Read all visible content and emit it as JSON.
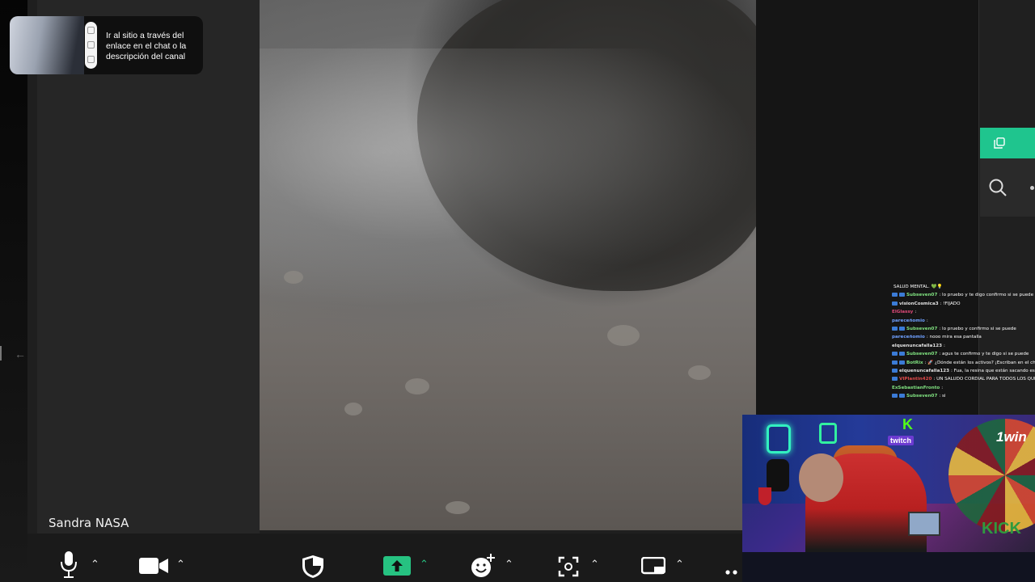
{
  "promo": {
    "text": "Ir al sitio a través del enlace en el chat o la descripción del canal"
  },
  "meeting": {
    "participant_name": "Sandra NASA"
  },
  "toolbar": {
    "icons": [
      "microphone-icon",
      "video-camera-icon",
      "security-shield-icon",
      "share-screen-icon",
      "reactions-icon",
      "apps-icon",
      "view-icon",
      "more-icon"
    ]
  },
  "side_panel": {
    "icons": [
      "copy-icon",
      "search-icon"
    ]
  },
  "chat": {
    "lines": [
      {
        "user": "",
        "user_color": "#ffffff",
        "text": "SALUD MENTAL. 💚💡",
        "badges": 0
      },
      {
        "user": "Subseven07",
        "user_color": "#7fe07f",
        "text": ": lo pruebo y te digo confirmo si se puede",
        "badges": 2
      },
      {
        "user": "visionCosmica3",
        "user_color": "#e0e0e0",
        "text": ": !FIJADO",
        "badges": 1
      },
      {
        "user": "ElGlassy",
        "user_color": "#e04a7a",
        "text": ":",
        "badges": 0
      },
      {
        "user": "pareceñomio",
        "user_color": "#6fa0ff",
        "text": ":",
        "badges": 0
      },
      {
        "user": "Subseven07",
        "user_color": "#7fe07f",
        "text": ": lo pruebo y confirmo si se puede",
        "badges": 2
      },
      {
        "user": "pareceñomio",
        "user_color": "#6fa0ff",
        "text": ": nooo mira esa pantalla",
        "badges": 0
      },
      {
        "user": "elquenuncafalla123",
        "user_color": "#e0e0e0",
        "text": ":",
        "badges": 0
      },
      {
        "user": "Subseven07",
        "user_color": "#7fe07f",
        "text": ": agus te confirmo y te digo si se puede",
        "badges": 2
      },
      {
        "user": "BotRix",
        "user_color": "#7fe07f",
        "text": ": 🚀 ¿Dónde están los activos? ¡Escriban en el chat",
        "badges": 2
      },
      {
        "user": "elquenuncafalla123",
        "user_color": "#e0e0e0",
        "text": ": Fua, la resina que están sacando esas planta locura total",
        "badges": 1
      },
      {
        "user": "VIPlantin420",
        "user_color": "#e04a4a",
        "text": ": UN SALUDO CORDIAL PARA TODOS LOS QUE HACEN CHILLING UNA GRAN FAMILIA",
        "badges": 1
      },
      {
        "user": "ExSebastianFronto",
        "user_color": "#7fe07f",
        "text": ":",
        "badges": 0
      },
      {
        "user": "Subseven07",
        "user_color": "#7fe07f",
        "text": ": si",
        "badges": 2
      }
    ]
  },
  "webcam": {
    "twitch_label": "twitch",
    "brand_label": "1win",
    "kick_label": "KICK"
  }
}
